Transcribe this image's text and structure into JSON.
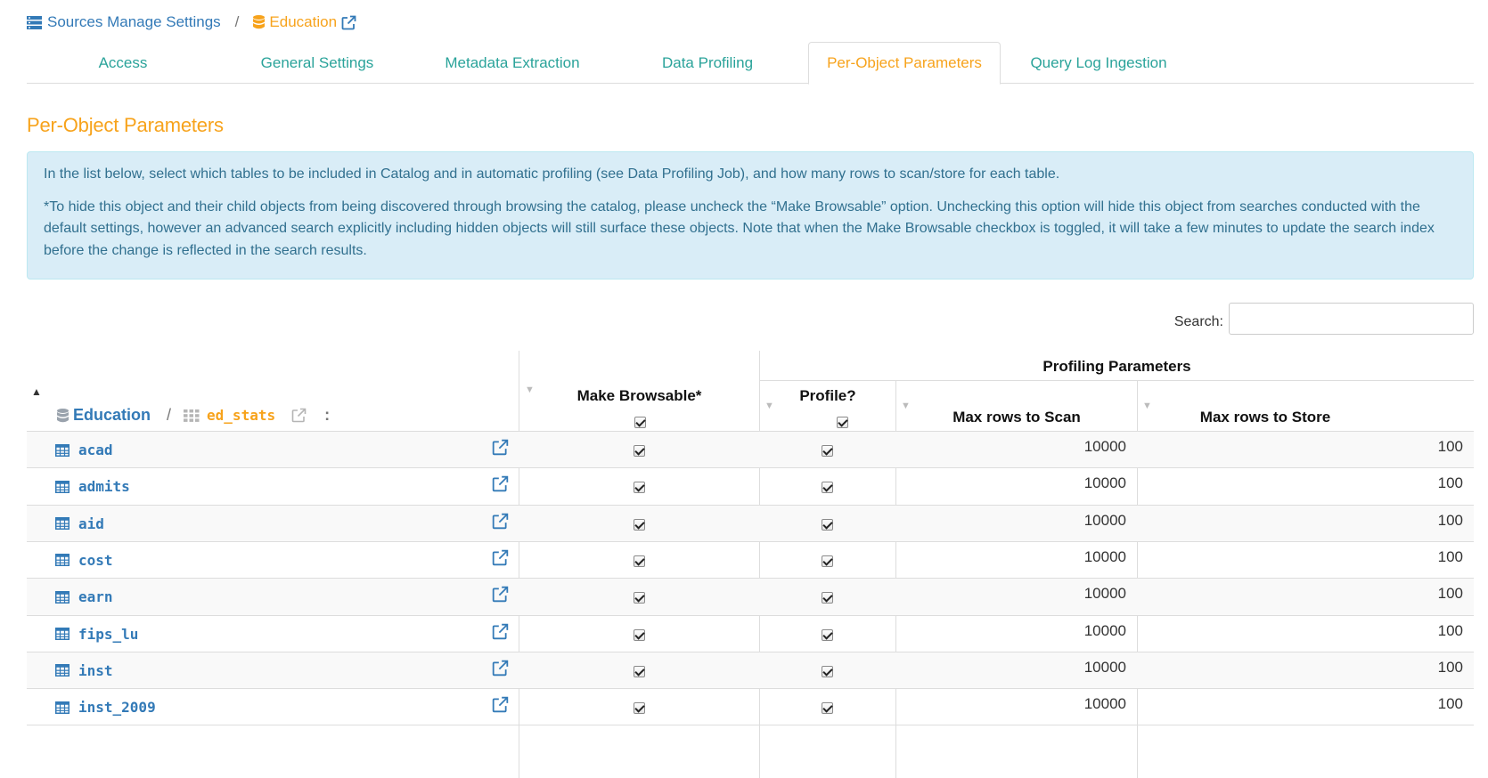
{
  "breadcrumb": {
    "parent_label": "Sources Manage Settings",
    "separator": "/",
    "current_label": "Education"
  },
  "tabs": [
    {
      "label": "Access",
      "active": false
    },
    {
      "label": "General Settings",
      "active": false
    },
    {
      "label": "Metadata Extraction",
      "active": false
    },
    {
      "label": "Data Profiling",
      "active": false
    },
    {
      "label": "Per-Object Parameters",
      "active": true
    },
    {
      "label": "Query Log Ingestion",
      "active": false
    }
  ],
  "section_title": "Per-Object Parameters",
  "info": {
    "paragraph1": "In the list below, select which tables to be included in Catalog and in automatic profiling (see Data Profiling Job), and how many rows to scan/store for each table.",
    "paragraph2": "*To hide this object and their child objects from being discovered through browsing the catalog, please uncheck the “Make Browsable” option. Unchecking this option will hide this object from searches conducted with the default settings, however an advanced search explicitly including hidden objects will still surface these objects. Note that when the Make Browsable checkbox is toggled, it will take a few minutes to update the search index before the change is reflected in the search results."
  },
  "search": {
    "label": "Search:",
    "value": "",
    "placeholder": ""
  },
  "table": {
    "path": {
      "database": "Education",
      "separator": "/",
      "schema": "ed_stats",
      "suffix": ":"
    },
    "headers": {
      "make_browsable": "Make Browsable*",
      "profiling_group": "Profiling Parameters",
      "profile": "Profile?",
      "max_scan": "Max rows to Scan",
      "max_store": "Max rows to Store"
    },
    "header_checks": {
      "make_browsable": true,
      "profile": true
    },
    "rows": [
      {
        "name": "acad",
        "browsable": true,
        "profile": true,
        "max_scan": "10000",
        "max_store": "100"
      },
      {
        "name": "admits",
        "browsable": true,
        "profile": true,
        "max_scan": "10000",
        "max_store": "100"
      },
      {
        "name": "aid",
        "browsable": true,
        "profile": true,
        "max_scan": "10000",
        "max_store": "100"
      },
      {
        "name": "cost",
        "browsable": true,
        "profile": true,
        "max_scan": "10000",
        "max_store": "100"
      },
      {
        "name": "earn",
        "browsable": true,
        "profile": true,
        "max_scan": "10000",
        "max_store": "100"
      },
      {
        "name": "fips_lu",
        "browsable": true,
        "profile": true,
        "max_scan": "10000",
        "max_store": "100"
      },
      {
        "name": "inst",
        "browsable": true,
        "profile": true,
        "max_scan": "10000",
        "max_store": "100"
      },
      {
        "name": "inst_2009",
        "browsable": true,
        "profile": true,
        "max_scan": "10000",
        "max_store": "100"
      }
    ]
  },
  "colors": {
    "link": "#337ab7",
    "accent_orange": "#f7a31c",
    "tab_teal": "#2aa39a",
    "info_bg": "#d9edf7",
    "info_text": "#31708f"
  },
  "icons": {
    "breadcrumb_parent": "server-stack-icon",
    "breadcrumb_current": "database-icon",
    "external_link": "external-link-icon",
    "schema": "grid-icon",
    "table_row": "table-icon"
  }
}
